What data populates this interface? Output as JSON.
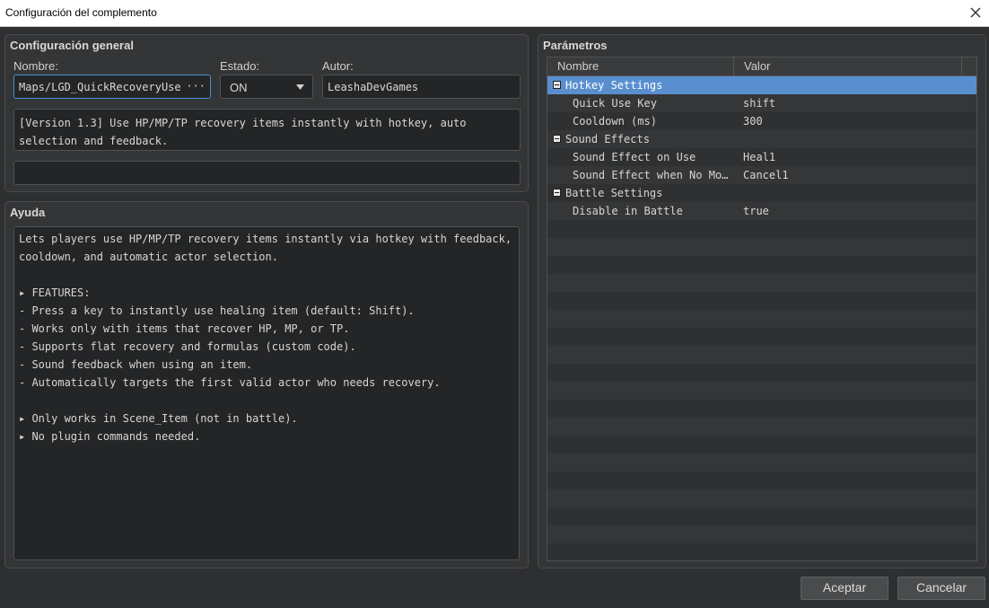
{
  "window": {
    "title": "Configuración del complemento",
    "close_icon": "close-icon"
  },
  "general": {
    "title": "Configuración general",
    "name_label": "Nombre:",
    "name_value": "Maps/LGD_QuickRecoveryUse",
    "name_button": "···",
    "status_label": "Estado:",
    "status_value": "ON",
    "author_label": "Autor:",
    "author_value": "LeashaDevGames",
    "description": "[Version 1.3] Use HP/MP/TP recovery items instantly with hotkey, auto selection and feedback.",
    "extra_value": ""
  },
  "help": {
    "title": "Ayuda",
    "text": "Lets players use HP/MP/TP recovery items instantly via hotkey with feedback,\ncooldown, and automatic actor selection.\n\n▸ FEATURES:\n- Press a key to instantly use healing item (default: Shift).\n- Works only with items that recover HP, MP, or TP.\n- Supports flat recovery and formulas (custom code).\n- Sound feedback when using an item.\n- Automatically targets the first valid actor who needs recovery.\n\n▸ Only works in Scene_Item (not in battle).\n▸ No plugin commands needed."
  },
  "params": {
    "title": "Parámetros",
    "col_name": "Nombre",
    "col_value": "Valor",
    "rows": [
      {
        "name": "Hotkey Settings",
        "value": "",
        "group": true,
        "selected": true
      },
      {
        "name": "Quick Use Key",
        "value": "shift",
        "group": false,
        "selected": false
      },
      {
        "name": "Cooldown (ms)",
        "value": "300",
        "group": false,
        "selected": false
      },
      {
        "name": "Sound Effects",
        "value": "",
        "group": true,
        "selected": false
      },
      {
        "name": "Sound Effect on Use",
        "value": "Heal1",
        "group": false,
        "selected": false
      },
      {
        "name": "Sound Effect when No Mo…",
        "value": "Cancel1",
        "group": false,
        "selected": false
      },
      {
        "name": "Battle Settings",
        "value": "",
        "group": true,
        "selected": false
      },
      {
        "name": "Disable in Battle",
        "value": "true",
        "group": false,
        "selected": false
      }
    ]
  },
  "buttons": {
    "accept": "Aceptar",
    "cancel": "Cancelar"
  },
  "colors": {
    "selection": "#5a8fcf",
    "background": "#2e2f30",
    "panel": "#343536"
  }
}
